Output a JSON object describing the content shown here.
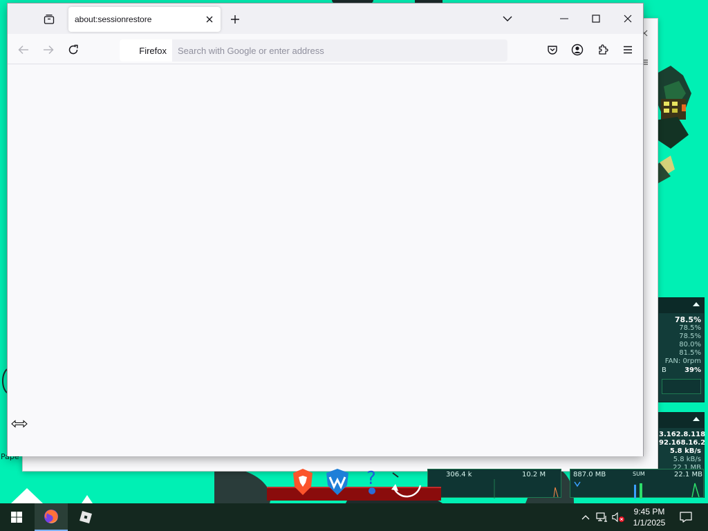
{
  "desktop": {
    "background_color": "#00f0b4",
    "side_label": "Pape",
    "gadget_cpu": {
      "total": "78.5%",
      "cores": [
        "78.5%",
        "78.5%",
        "80.0%",
        "81.5%"
      ],
      "fan": "FAN: 0rpm",
      "mem_prefix": "B",
      "mem_pct": "39%"
    },
    "gadget_net": {
      "ip_public": "3.162.8.118",
      "ip_local": "92.168.16.2",
      "rate_primary": "5.8 kB/s",
      "rate_secondary": "5.8 kB/s",
      "total": "22.1 MB",
      "sum_label": "SUM",
      "mem_label": "887.0 MB"
    },
    "graph_left": {
      "left_value": "306.4 k",
      "right_value": "10.2 M"
    }
  },
  "browser": {
    "tab": {
      "title": "about:sessionrestore"
    },
    "identity_label": "Firefox",
    "url": {
      "value": "",
      "placeholder": "Search with Google or enter address"
    }
  },
  "taskbar": {
    "clock": {
      "time": "9:45 PM",
      "date": "1/1/2025"
    },
    "apps": [
      "firefox-icon",
      "roblox-icon"
    ],
    "accent_color": "#7fb3ff"
  }
}
